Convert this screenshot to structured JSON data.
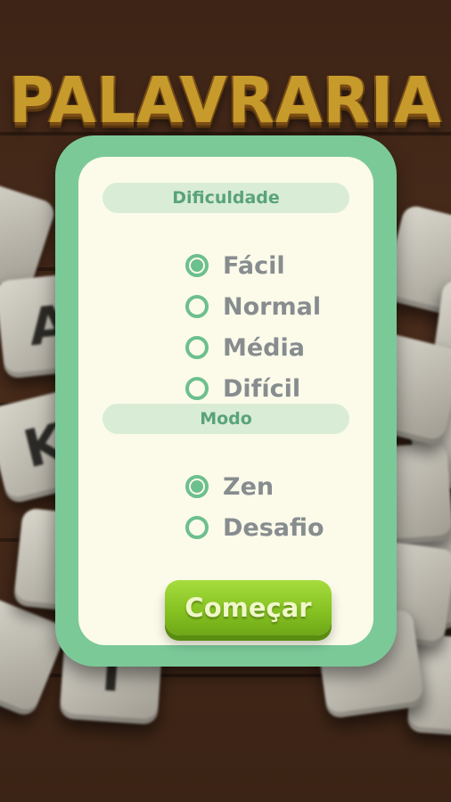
{
  "game": {
    "title": "PALAVRARIA"
  },
  "background_tiles": [
    "",
    "A",
    "",
    "K",
    "",
    "",
    "T",
    "",
    "",
    "",
    "",
    "",
    "",
    "",
    ""
  ],
  "difficulty": {
    "header": "Dificuldade",
    "options": [
      {
        "label": "Fácil",
        "selected": true
      },
      {
        "label": "Normal",
        "selected": false
      },
      {
        "label": "Média",
        "selected": false
      },
      {
        "label": "Difícil",
        "selected": false
      }
    ]
  },
  "mode": {
    "header": "Modo",
    "options": [
      {
        "label": "Zen",
        "selected": true
      },
      {
        "label": "Desafio",
        "selected": false
      }
    ]
  },
  "start_button": {
    "label": "Começar"
  },
  "colors": {
    "panel_border": "#7cc998",
    "panel_fill": "#fcfbea",
    "radio": "#6cc08e",
    "button_green": "#86c322",
    "title_gold": "#c79a2c"
  }
}
